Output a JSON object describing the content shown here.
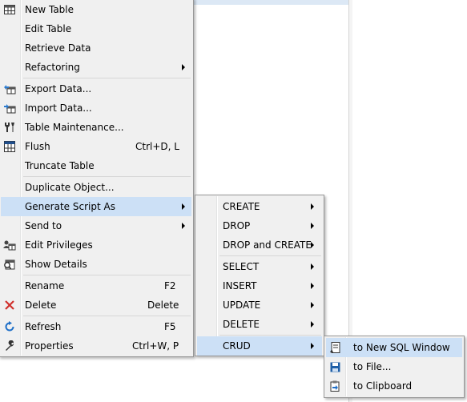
{
  "context_menu": {
    "items": [
      {
        "label": "New Table",
        "icon": "new-table-icon"
      },
      {
        "label": "Edit Table",
        "icon": ""
      },
      {
        "label": "Retrieve Data",
        "icon": ""
      },
      {
        "label": "Refactoring",
        "icon": "",
        "submenu": true
      },
      {
        "label": "Export Data...",
        "icon": "export-data-icon"
      },
      {
        "label": "Import Data...",
        "icon": "import-data-icon"
      },
      {
        "label": "Table Maintenance...",
        "icon": "maintenance-icon"
      },
      {
        "label": "Flush",
        "icon": "flush-icon",
        "shortcut": "Ctrl+D, L"
      },
      {
        "label": "Truncate Table",
        "icon": ""
      },
      {
        "label": "Duplicate Object...",
        "icon": ""
      },
      {
        "label": "Generate Script As",
        "icon": "",
        "submenu": true,
        "highlighted": true
      },
      {
        "label": "Send to",
        "icon": "",
        "submenu": true
      },
      {
        "label": "Edit Privileges",
        "icon": "privileges-icon"
      },
      {
        "label": "Show Details",
        "icon": "details-icon"
      },
      {
        "label": "Rename",
        "icon": "",
        "shortcut": "F2"
      },
      {
        "label": "Delete",
        "icon": "delete-icon",
        "shortcut": "Delete"
      },
      {
        "label": "Refresh",
        "icon": "refresh-icon",
        "shortcut": "F5"
      },
      {
        "label": "Properties",
        "icon": "properties-icon",
        "shortcut": "Ctrl+W, P"
      }
    ]
  },
  "generate_script_submenu": {
    "items": [
      {
        "label": "CREATE",
        "submenu": true
      },
      {
        "label": "DROP",
        "submenu": true
      },
      {
        "label": "DROP and CREATE",
        "submenu": true
      },
      {
        "label": "SELECT",
        "submenu": true
      },
      {
        "label": "INSERT",
        "submenu": true
      },
      {
        "label": "UPDATE",
        "submenu": true
      },
      {
        "label": "DELETE",
        "submenu": true
      },
      {
        "label": "CRUD",
        "submenu": true,
        "highlighted": true
      }
    ]
  },
  "crud_submenu": {
    "items": [
      {
        "label": "to New SQL Window",
        "icon": "new-sql-window-icon",
        "highlighted": true
      },
      {
        "label": "to File...",
        "icon": "save-file-icon"
      },
      {
        "label": "to Clipboard",
        "icon": "clipboard-icon"
      }
    ]
  },
  "colors": {
    "menu_bg": "#f0f0f0",
    "highlight": "#cce0f6",
    "border": "#979797"
  }
}
